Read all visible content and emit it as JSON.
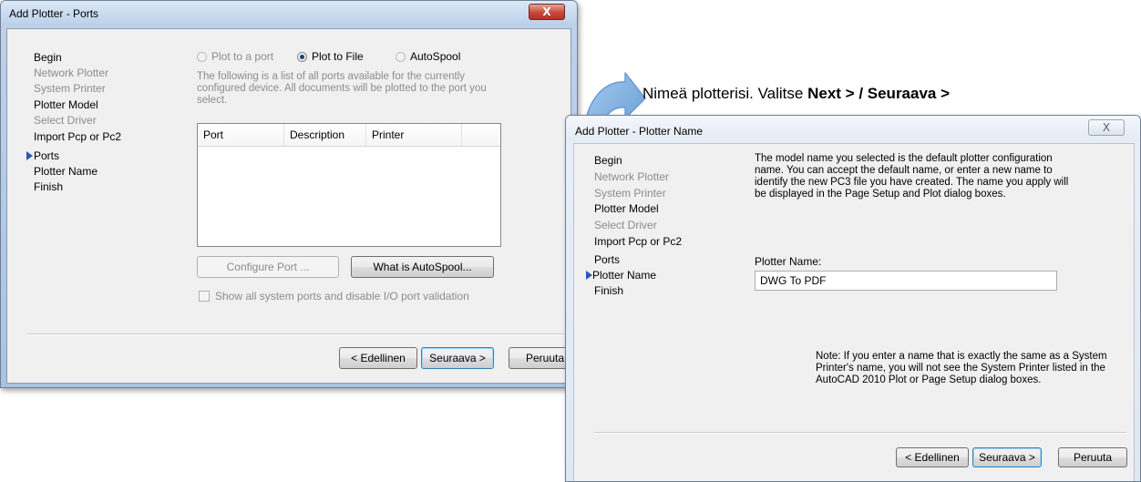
{
  "annotation": {
    "text_prefix": "Nimeä plotterisi. Valitse ",
    "text_bold": "Next > / Seuraava >"
  },
  "ports_dialog": {
    "title": "Add Plotter - Ports",
    "close_label": "X",
    "steps": [
      {
        "label": "Begin",
        "state": "done"
      },
      {
        "label": "Network Plotter",
        "state": "disabled"
      },
      {
        "label": "System Printer",
        "state": "disabled"
      },
      {
        "label": "Plotter Model",
        "state": "done"
      },
      {
        "label": "Select Driver",
        "state": "disabled"
      },
      {
        "label": "Import Pcp or Pc2",
        "state": "done"
      },
      {
        "label": "Ports",
        "state": "current"
      },
      {
        "label": "Plotter Name",
        "state": "done"
      },
      {
        "label": "Finish",
        "state": "done"
      }
    ],
    "radio_plot_to_port": "Plot to a port",
    "radio_plot_to_file": "Plot to File",
    "radio_autospool": "AutoSpool",
    "selected_radio": "Plot to File",
    "description": "The following is a list of all ports available for the currently configured device. All documents will be plotted to the port you select.",
    "columns": [
      "Port",
      "Description",
      "Printer"
    ],
    "configure_port": "Configure Port ...",
    "what_is_autospool": "What is AutoSpool...",
    "show_all_ports": "Show all system ports and disable I/O port validation",
    "back": "< Edellinen",
    "next": "Seuraava >",
    "cancel": "Peruuta"
  },
  "name_dialog": {
    "title": "Add Plotter - Plotter Name",
    "close_label": "X",
    "steps": [
      {
        "label": "Begin",
        "state": "done"
      },
      {
        "label": "Network Plotter",
        "state": "disabled"
      },
      {
        "label": "System Printer",
        "state": "disabled"
      },
      {
        "label": "Plotter Model",
        "state": "done"
      },
      {
        "label": "Select Driver",
        "state": "disabled"
      },
      {
        "label": "Import Pcp or Pc2",
        "state": "done"
      },
      {
        "label": "Ports",
        "state": "done"
      },
      {
        "label": "Plotter Name",
        "state": "current"
      },
      {
        "label": "Finish",
        "state": "done"
      }
    ],
    "description": "The model name you selected is the default plotter configuration name. You can accept the default name, or enter a new name to identify the new PC3 file you have created. The name you apply will be displayed in the Page Setup and Plot dialog boxes.",
    "plotter_name_label": "Plotter Name:",
    "plotter_name_value": "DWG To PDF",
    "note": "Note: If you enter a name that is exactly the same as a System Printer's name, you will not see the System Printer listed in the AutoCAD 2010 Plot or Page Setup dialog boxes.",
    "back": "< Edellinen",
    "next": "Seuraava >",
    "cancel": "Peruuta"
  },
  "colors": {
    "pointer_arrow": "#e11b1b",
    "curved_arrow": "#7fb0e0",
    "step_marker": "#2a58b4"
  },
  "icons": [
    "red-pointer-arrow-icon",
    "curved-arrow-icon",
    "step-marker-arrow-icon",
    "close-icon"
  ]
}
